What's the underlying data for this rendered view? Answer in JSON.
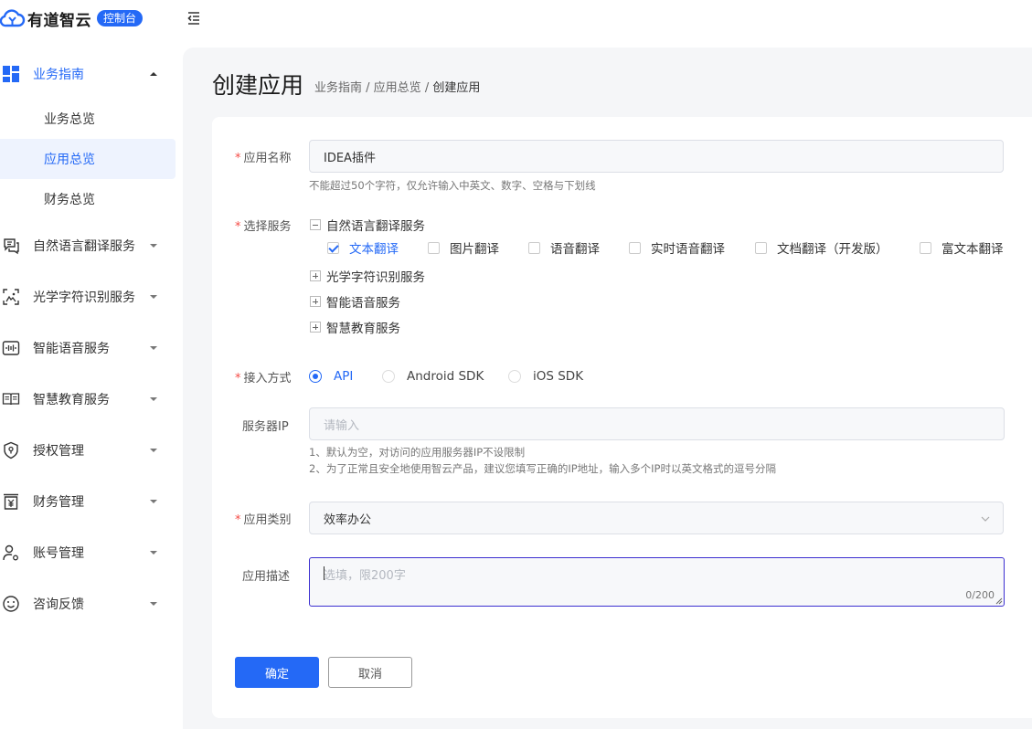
{
  "brand": {
    "name": "有道智云",
    "badge": "控制台",
    "accent": "#2469f6"
  },
  "sidebar": {
    "groups": [
      {
        "label": "业务指南",
        "icon": "dashboard-grid-icon",
        "expanded": true,
        "items": [
          {
            "label": "业务总览"
          },
          {
            "label": "应用总览",
            "active": true
          },
          {
            "label": "财务总览"
          }
        ]
      },
      {
        "label": "自然语言翻译服务",
        "icon": "translate-chat-icon"
      },
      {
        "label": "光学字符识别服务",
        "icon": "scan-icon"
      },
      {
        "label": "智能语音服务",
        "icon": "voice-wave-icon"
      },
      {
        "label": "智慧教育服务",
        "icon": "education-book-icon"
      },
      {
        "label": "授权管理",
        "icon": "shield-icon"
      },
      {
        "label": "财务管理",
        "icon": "yuan-bill-icon"
      },
      {
        "label": "账号管理",
        "icon": "user-settings-icon"
      },
      {
        "label": "咨询反馈",
        "icon": "smile-feedback-icon"
      }
    ]
  },
  "page": {
    "title": "创建应用",
    "breadcrumb": {
      "part1": "业务指南",
      "part2": "应用总览",
      "current": "创建应用",
      "sep": " / "
    }
  },
  "form": {
    "required_mark": "*",
    "app_name": {
      "label": "应用名称",
      "value": "IDEA插件",
      "hint": "不能超过50个字符，仅允许输入中英文、数字、空格与下划线"
    },
    "services": {
      "label": "选择服务",
      "nlp": {
        "label": "自然语言翻译服务",
        "options": [
          {
            "label": "文本翻译",
            "checked": true
          },
          {
            "label": "图片翻译",
            "checked": false
          },
          {
            "label": "语音翻译",
            "checked": false
          },
          {
            "label": "实时语音翻译",
            "checked": false
          },
          {
            "label": "文档翻译（开发版）",
            "checked": false
          },
          {
            "label": "富文本翻译",
            "checked": false
          }
        ]
      },
      "ocr": "光学字符识别服务",
      "speech": "智能语音服务",
      "education": "智慧教育服务"
    },
    "access": {
      "label": "接入方式",
      "options": [
        {
          "label": "API",
          "selected": true
        },
        {
          "label": "Android SDK",
          "selected": false
        },
        {
          "label": "iOS SDK",
          "selected": false
        }
      ]
    },
    "server_ip": {
      "label": "服务器IP",
      "placeholder": "请输入",
      "hint1": "1、默认为空，对访问的应用服务器IP不设限制",
      "hint2": "2、为了正常且安全地使用智云产品，建议您填写正确的IP地址，输入多个IP时以英文格式的逗号分隔"
    },
    "category": {
      "label": "应用类别",
      "value": "效率办公"
    },
    "description": {
      "label": "应用描述",
      "placeholder": "选填，限200字",
      "counter": "0/200"
    },
    "buttons": {
      "confirm": "确定",
      "cancel": "取消"
    }
  }
}
